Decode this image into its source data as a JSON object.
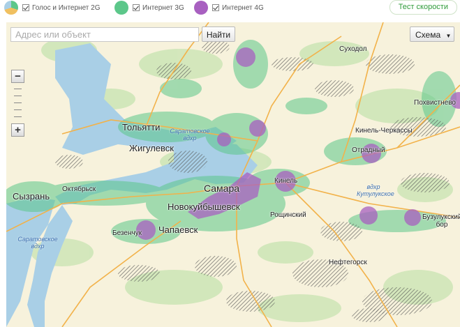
{
  "colors": {
    "g2": "#f0c060",
    "g3": "#5cc78a",
    "g4": "#a860c0",
    "map_bg": "#f7f2dc",
    "water": "#a9cfe6",
    "road": "#f2b24a"
  },
  "legend": {
    "items": [
      {
        "id": "2g",
        "label": "Голос и Интернет 2G",
        "checked": true
      },
      {
        "id": "3g",
        "label": "Интернет 3G",
        "checked": true
      },
      {
        "id": "4g",
        "label": "Интернет 4G",
        "checked": true
      }
    ]
  },
  "speed_test": {
    "label": "Тест скорости"
  },
  "search": {
    "placeholder": "Адрес или объект",
    "button": "Найти"
  },
  "map_type": {
    "selected": "Схема"
  },
  "zoom": {
    "in_icon": "plus-icon",
    "out_icon": "minus-icon"
  },
  "map_labels": {
    "samara": "Самара",
    "tolyatti": "Тольятти",
    "zhigulevsk": "Жигулевск",
    "syzran": "Сызрань",
    "novokuybyshevsk": "Новокуйбышевск",
    "chapaevsk": "Чапаевск",
    "oktyabrsk": "Октябрьск",
    "bezenchuk": "Безенчук",
    "kinel": "Кинель",
    "kinel_cherkassy": "Кинель-Черкассы",
    "otradny": "Отрадный",
    "pokhvistnevo": "Похвистнево",
    "sukhodol": "Суходол",
    "roshchinsky": "Рощинский",
    "neftegorsk": "Нефтегорск",
    "buzuluksky_bor": "Бузулукский бор",
    "saratov_res_1": "Саратовское вдхр",
    "saratov_res_2": "Саратовское вдхр",
    "kutuluk_res": "вдхр Кутулукское"
  }
}
